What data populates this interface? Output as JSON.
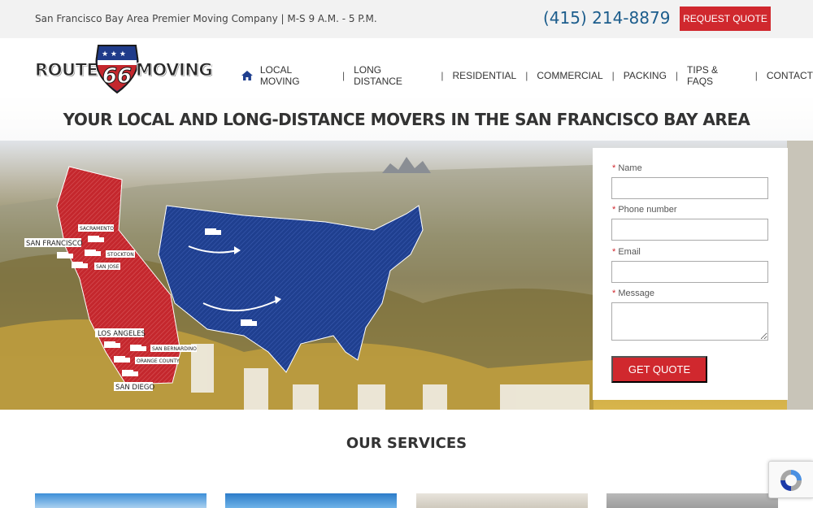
{
  "topbar": {
    "tagline": "San Francisco Bay Area Premier Moving Company | M-S 9 A.M. - 5 P.M.",
    "phone": "(415) 214-8879",
    "request_quote": "REQUEST QUOTE"
  },
  "logo": {
    "left_word": "ROUTE",
    "number": "66",
    "right_word": "MOVING"
  },
  "nav": {
    "items": [
      "LOCAL MOVING",
      "LONG DISTANCE",
      "RESIDENTIAL",
      "COMMERCIAL",
      "PACKING",
      "TIPS & FAQS",
      "CONTACT"
    ],
    "separator": "|"
  },
  "hero": {
    "title": "YOUR LOCAL AND LONG-DISTANCE MOVERS IN THE SAN FRANCISCO BAY AREA",
    "map_labels": {
      "sacramento": "SACRAMENTO",
      "san_francisco": "SAN FRANCISCO",
      "stockton": "STOCKTON",
      "san_jose": "SAN JOSE",
      "los_angeles": "LOS ANGELES",
      "san_bernardino": "SAN BERNARDINO",
      "orange_county": "ORANGE COUNTY",
      "san_diego": "SAN DIEGO"
    }
  },
  "form": {
    "required_mark": "*",
    "name_label": "Name",
    "phone_label": "Phone number",
    "email_label": "Email",
    "message_label": "Message",
    "submit": "GET QUOTE"
  },
  "services": {
    "title": "OUR SERVICES"
  },
  "colors": {
    "accent_red": "#d0282e",
    "phone_blue": "#1c5d8c",
    "map_blue": "#1f3f8f",
    "map_red": "#c4272d"
  },
  "icons": {
    "home": "home-icon",
    "truck": "truck-icon",
    "recaptcha": "recaptcha-icon"
  }
}
